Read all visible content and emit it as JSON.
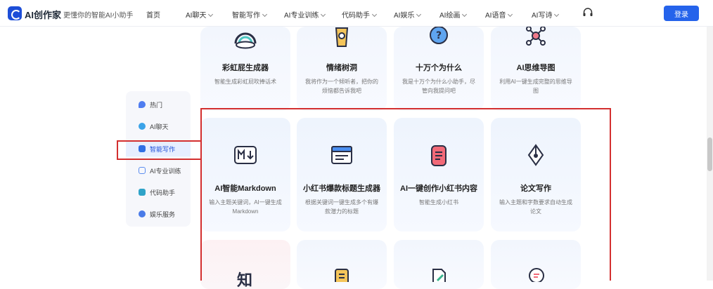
{
  "header": {
    "logo_text": "AI创作家",
    "slogan": "更懂你的智能AI小助手",
    "nav": [
      {
        "label": "首页",
        "has_dropdown": false
      },
      {
        "label": "AI聊天",
        "has_dropdown": true
      },
      {
        "label": "智能写作",
        "has_dropdown": true
      },
      {
        "label": "AI专业训练",
        "has_dropdown": true
      },
      {
        "label": "代码助手",
        "has_dropdown": true
      },
      {
        "label": "AI娱乐",
        "has_dropdown": true
      },
      {
        "label": "AI绘画",
        "has_dropdown": true
      },
      {
        "label": "AI语音",
        "has_dropdown": true
      },
      {
        "label": "AI写诗",
        "has_dropdown": true
      }
    ],
    "support_icon": "headset-icon",
    "login_label": "登录",
    "accent_color": "#2563eb"
  },
  "side_menu": {
    "items": [
      {
        "label": "热门",
        "icon": "flame-icon",
        "color": "#4f7df0",
        "active": false
      },
      {
        "label": "AI聊天",
        "icon": "chat-icon",
        "color": "#3ba3e8",
        "active": false
      },
      {
        "label": "智能写作",
        "icon": "write-icon",
        "color": "#2f6fe4",
        "active": true
      },
      {
        "label": "AI专业训练",
        "icon": "cube-icon",
        "color": "#5b8def",
        "active": false
      },
      {
        "label": "代码助手",
        "icon": "code-icon",
        "color": "#2fa3c8",
        "active": false
      },
      {
        "label": "娱乐服务",
        "icon": "smile-icon",
        "color": "#4a7be8",
        "active": false
      }
    ]
  },
  "cards_top": [
    {
      "title": "彩虹屁生成器",
      "desc": "智能生成彩虹屁吹捧话术",
      "icon": "rainbow-cloud-icon"
    },
    {
      "title": "情绪树洞",
      "desc": "我将作为一个倾听者，把你的烦恼都告诉我吧",
      "icon": "tree-hole-icon"
    },
    {
      "title": "十万个为什么",
      "desc": "我是十万个为什么小助手，尽管向我提问吧",
      "icon": "question-icon"
    },
    {
      "title": "AI思维导图",
      "desc": "利用AI一键生成完整的思维导图",
      "icon": "mindmap-icon"
    }
  ],
  "cards_main": [
    {
      "title": "AI智能Markdown",
      "desc": "输入主题关键词，AI一键生成Markdown",
      "icon": "markdown-icon"
    },
    {
      "title": "小红书爆款标题生成器",
      "desc": "根据关键词一键生成多个有爆款潜力的标题",
      "icon": "title-window-icon"
    },
    {
      "title": "AI一键创作小红书内容",
      "desc": "智能生成小红书",
      "icon": "note-icon"
    },
    {
      "title": "论文写作",
      "desc": "输入主题和字数要求自动生成论文",
      "icon": "pen-nib-icon"
    }
  ],
  "cards_bottom": [
    {
      "icon_char": "知",
      "icon": "zhi-icon"
    },
    {
      "icon": "document-icon"
    },
    {
      "icon": "edit-file-icon"
    },
    {
      "icon": "search-file-icon"
    }
  ],
  "highlight_color": "#d32f2f"
}
